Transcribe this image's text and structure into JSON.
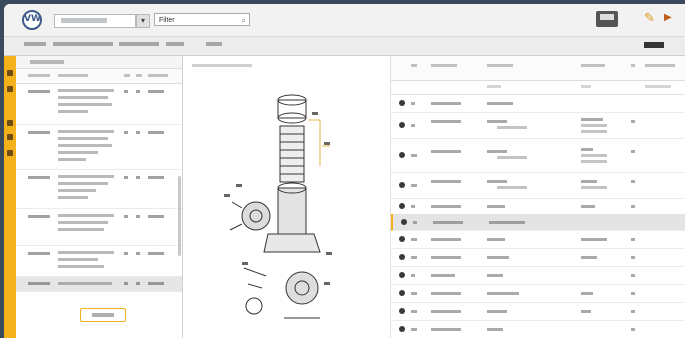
{
  "header": {
    "logo_text": "VW",
    "filter_placeholder": "Filter"
  },
  "colors": {
    "accent": "#f3b21b",
    "frame": "#3a4a5c"
  },
  "icons": [
    "vw-logo-icon",
    "chevron-down-icon",
    "search-icon",
    "print-icon",
    "pencil-icon",
    "arrow-right-icon"
  ]
}
